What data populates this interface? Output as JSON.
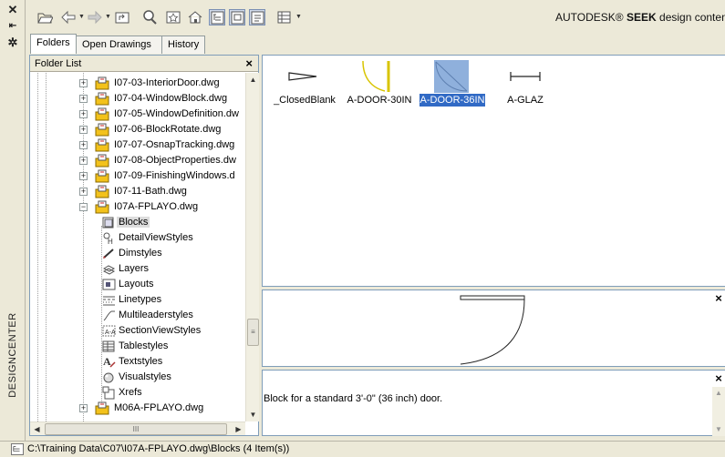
{
  "window": {
    "vertical_title": "DESIGNCENTER",
    "strip_buttons": [
      "close-icon",
      "auto-hide-icon",
      "properties-icon"
    ]
  },
  "toolbar": {
    "brand_name": "AUTODESK®",
    "brand_seek": "SEEK",
    "brand_suffix": "design content",
    "buttons": [
      "load-icon",
      "back-icon",
      "forward-icon",
      "up-icon",
      "search-icon",
      "favorites-icon",
      "home-icon",
      "tree-view-toggle-icon",
      "preview-toggle-icon",
      "description-toggle-icon",
      "views-icon"
    ]
  },
  "tabs": [
    {
      "label": "Folders",
      "active": true
    },
    {
      "label": "Open Drawings",
      "active": false
    },
    {
      "label": "History",
      "active": false
    }
  ],
  "folder_list": {
    "header": "Folder List",
    "close_glyph": "×",
    "files": [
      {
        "label": "I07-03-InteriorDoor.dwg",
        "expander": "+"
      },
      {
        "label": "I07-04-WindowBlock.dwg",
        "expander": "+"
      },
      {
        "label": "I07-05-WindowDefinition.dw",
        "expander": "+"
      },
      {
        "label": "I07-06-BlockRotate.dwg",
        "expander": "+"
      },
      {
        "label": "I07-07-OsnapTracking.dwg",
        "expander": "+"
      },
      {
        "label": "I07-08-ObjectProperties.dw",
        "expander": "+"
      },
      {
        "label": "I07-09-FinishingWindows.d",
        "expander": "+"
      },
      {
        "label": "I07-11-Bath.dwg",
        "expander": "+"
      },
      {
        "label": "I07A-FPLAYO.dwg",
        "expander": "−"
      }
    ],
    "children": [
      {
        "label": "Blocks",
        "icon": "blocks-icon",
        "selected": true
      },
      {
        "label": "DetailViewStyles",
        "icon": "detail-view-styles-icon"
      },
      {
        "label": "Dimstyles",
        "icon": "dimstyles-icon"
      },
      {
        "label": "Layers",
        "icon": "layers-icon"
      },
      {
        "label": "Layouts",
        "icon": "layouts-icon"
      },
      {
        "label": "Linetypes",
        "icon": "linetypes-icon"
      },
      {
        "label": "Multileaderstyles",
        "icon": "multileaderstyles-icon"
      },
      {
        "label": "SectionViewStyles",
        "icon": "section-view-styles-icon"
      },
      {
        "label": "Tablestyles",
        "icon": "tablestyles-icon"
      },
      {
        "label": "Textstyles",
        "icon": "textstyles-icon"
      },
      {
        "label": "Visualstyles",
        "icon": "visualstyles-icon"
      },
      {
        "label": "Xrefs",
        "icon": "xrefs-icon"
      }
    ],
    "last_file": {
      "label": "M06A-FPLAYO.dwg",
      "expander": "+"
    },
    "hscroll_grip": "III"
  },
  "content": {
    "blocks": [
      {
        "name": "_ClosedBlank",
        "selected": false
      },
      {
        "name": "A-DOOR-30IN",
        "selected": false
      },
      {
        "name": "A-DOOR-36IN",
        "selected": true
      },
      {
        "name": "A-GLAZ",
        "selected": false
      }
    ]
  },
  "preview": {
    "close_glyph": "×"
  },
  "description": {
    "text": "Block for a standard 3'-0\" (36 inch) door.",
    "close_glyph": "×"
  },
  "status": {
    "path": "C:\\Training Data\\C07\\I07A-FPLAYO.dwg\\Blocks (4 Item(s))"
  },
  "colors": {
    "selection": "#316ac5",
    "door_yellow": "#d8c400",
    "panel_border": "#7f9db9",
    "chrome": "#ece9d8"
  }
}
